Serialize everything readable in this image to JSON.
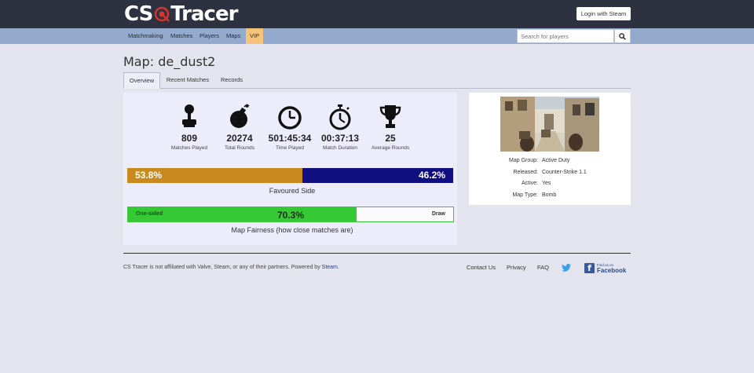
{
  "brand": {
    "part1": "CS",
    "part2": "Tracer"
  },
  "header": {
    "login_label": "Login with Steam"
  },
  "nav": {
    "items": [
      "Matchmaking",
      "Matches",
      "Players",
      "Maps",
      "VIP"
    ],
    "search_placeholder": "Search for players"
  },
  "page": {
    "title": "Map: de_dust2"
  },
  "tabs": [
    "Overview",
    "Recent Matches",
    "Records"
  ],
  "stats": [
    {
      "icon": "joystick-icon",
      "value": "809",
      "label": "Matches Played"
    },
    {
      "icon": "bomb-icon",
      "value": "20274",
      "label": "Total Rounds"
    },
    {
      "icon": "clock-icon",
      "value": "501:45:34",
      "label": "Time Played"
    },
    {
      "icon": "stopwatch-icon",
      "value": "00:37:13",
      "label": "Match Duration"
    },
    {
      "icon": "trophy-icon",
      "value": "25",
      "label": "Average Rounds"
    }
  ],
  "favoured_side": {
    "left_value": "53.8%",
    "right_value": "46.2%",
    "left_fraction": 0.538,
    "caption": "Favoured Side",
    "colors": {
      "left": "#c98a1d",
      "right": "#0f0f80"
    }
  },
  "fairness": {
    "left_label": "One-sided",
    "value": "70.3%",
    "fraction": 0.703,
    "right_label": "Draw",
    "caption": "Map Fairness (how close matches are)",
    "color": "#35c935"
  },
  "map_info": [
    {
      "key": "Map Group:",
      "value": "Active Duty"
    },
    {
      "key": "Released:",
      "value": "Counter-Strike 1.1"
    },
    {
      "key": "Active:",
      "value": "Yes"
    },
    {
      "key": "Map Type:",
      "value": "Bomb"
    }
  ],
  "footer": {
    "disclaimer": "CS Tracer is not affiliated with Valve, Steam, or any of their partners. Powered by",
    "steam_link": "Steam",
    "period": ".",
    "links": [
      "Contact Us",
      "Privacy",
      "FAQ"
    ],
    "facebook_small": "Find us on",
    "facebook_big": "Facebook"
  }
}
